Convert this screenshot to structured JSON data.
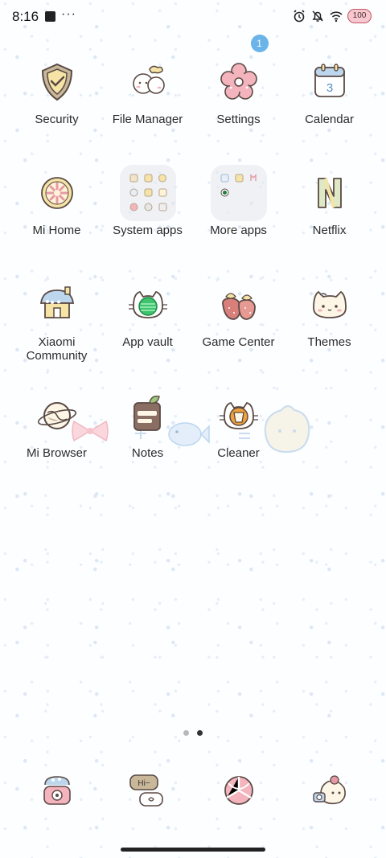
{
  "status_bar": {
    "time": "8:16",
    "more": "···",
    "battery": "100",
    "icons": [
      "app-notification-icon",
      "alarm-icon",
      "silent-icon",
      "wifi-icon"
    ]
  },
  "apps": [
    {
      "label": "Security",
      "icon": "shield-icon"
    },
    {
      "label": "File Manager",
      "icon": "folder-clouds-icon"
    },
    {
      "label": "Settings",
      "icon": "flower-gear-icon",
      "badge": "1"
    },
    {
      "label": "Calendar",
      "icon": "calendar-icon",
      "day": "3"
    },
    {
      "label": "Mi Home",
      "icon": "mi-home-icon"
    },
    {
      "label": "System apps",
      "icon": "folder-icon"
    },
    {
      "label": "More apps",
      "icon": "folder-icon"
    },
    {
      "label": "Netflix",
      "icon": "netflix-icon",
      "glyph": "N"
    },
    {
      "label": "Xiaomi Community",
      "label_lines": [
        "Xiaomi",
        "Community"
      ],
      "icon": "house-icon"
    },
    {
      "label": "App vault",
      "icon": "cat-orb-icon"
    },
    {
      "label": "Game Center",
      "icon": "strawberries-icon"
    },
    {
      "label": "Themes",
      "icon": "cat-face-icon"
    },
    {
      "label": "Mi Browser",
      "icon": "planet-icon"
    },
    {
      "label": "Notes",
      "icon": "notebook-icon"
    },
    {
      "label": "Cleaner",
      "icon": "cat-cup-icon"
    }
  ],
  "dock": [
    {
      "name": "phone-icon"
    },
    {
      "name": "messages-icon",
      "bubble_text": "Hi~"
    },
    {
      "name": "browser-icon"
    },
    {
      "name": "camera-icon"
    }
  ],
  "page_indicator": {
    "pages": 2,
    "active": 2
  },
  "colors": {
    "badge": "#6ab4ea",
    "text": "#2b2b2b",
    "icon_outline": "#5a4a44",
    "accent_pink": "#f4b4bd",
    "accent_blue": "#bcd6ee",
    "accent_yellow": "#f5e4a6"
  }
}
